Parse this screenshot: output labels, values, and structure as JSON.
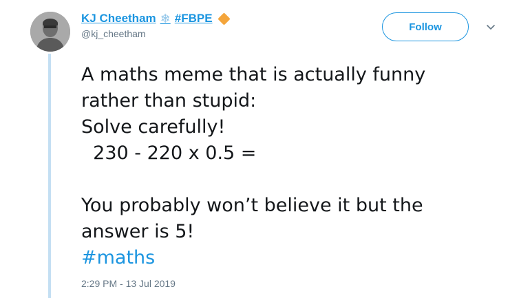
{
  "author": {
    "display_name": "KJ Cheetham",
    "name_suffix": "#FBPE",
    "handle": "@kj_cheetham"
  },
  "follow_button": {
    "label": "Follow"
  },
  "tweet": {
    "lines": [
      "A maths meme that is actually funny",
      "rather than stupid:",
      "Solve carefully!",
      "  230 - 220 x 0.5 =",
      "",
      "You probably won’t believe it but the",
      "answer is 5!"
    ],
    "hashtag": "#maths",
    "timestamp": "2:29 PM - 13 Jul 2019"
  },
  "colors": {
    "link_blue": "#1b95e0",
    "thread_line": "#c4dff3",
    "meta_gray": "#657786",
    "diamond_orange": "#f4a53b"
  },
  "icons": [
    "avatar",
    "snowflake-icon",
    "diamond-icon",
    "chevron-down-icon"
  ]
}
